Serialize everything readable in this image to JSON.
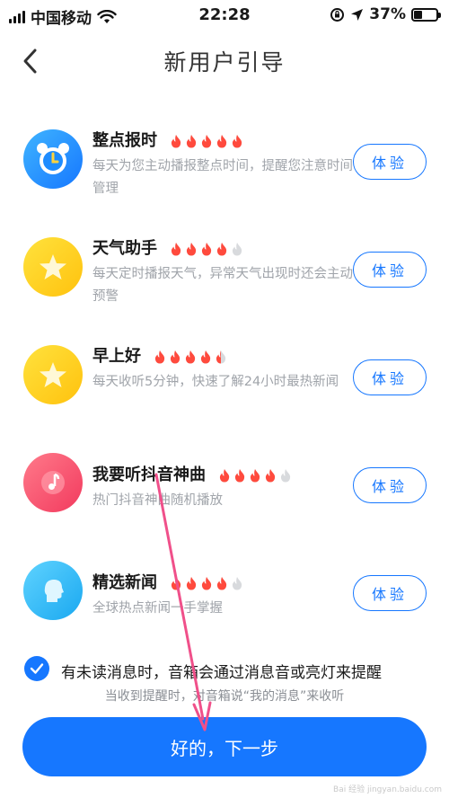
{
  "status_bar": {
    "carrier": "中国移动",
    "time": "22:28",
    "battery_text": "37%",
    "battery_level": 0.37
  },
  "nav": {
    "back_icon": "chevron-left-icon",
    "title": "新用户引导"
  },
  "colors": {
    "accent": "#1677ff",
    "flame_active": "#ff4a3d",
    "flame_inactive": "#d8dadd"
  },
  "features": [
    {
      "title": "整点报时",
      "rating": 5,
      "desc": "每天为您主动播报整点时间，提醒您注意时间管理",
      "button": "体验",
      "icon": "alarm-clock-icon"
    },
    {
      "title": "天气助手",
      "rating": 4,
      "desc": "每天定时播报天气，异常天气出现时还会主动预警",
      "button": "体验",
      "icon": "star-icon"
    },
    {
      "title": "早上好",
      "rating": 4.5,
      "desc": "每天收听5分钟，快速了解24小时最热新闻",
      "button": "体验",
      "icon": "star-icon"
    },
    {
      "title": "我要听抖音神曲",
      "rating": 4,
      "desc": "热门抖音神曲随机播放",
      "button": "体验",
      "icon": "music-note-icon"
    },
    {
      "title": "精选新闻",
      "rating": 4,
      "desc": "全球热点新闻一手掌握",
      "button": "体验",
      "icon": "profile-head-icon"
    }
  ],
  "notification": {
    "checked": true,
    "label": "有未读消息时，音箱会通过消息音或亮灯来提醒",
    "hint": "当收到提醒时，对音箱说“我的消息”来收听"
  },
  "primary_button": "好的，下一步",
  "watermark": "Bai 经验 jingyan.baidu.com"
}
